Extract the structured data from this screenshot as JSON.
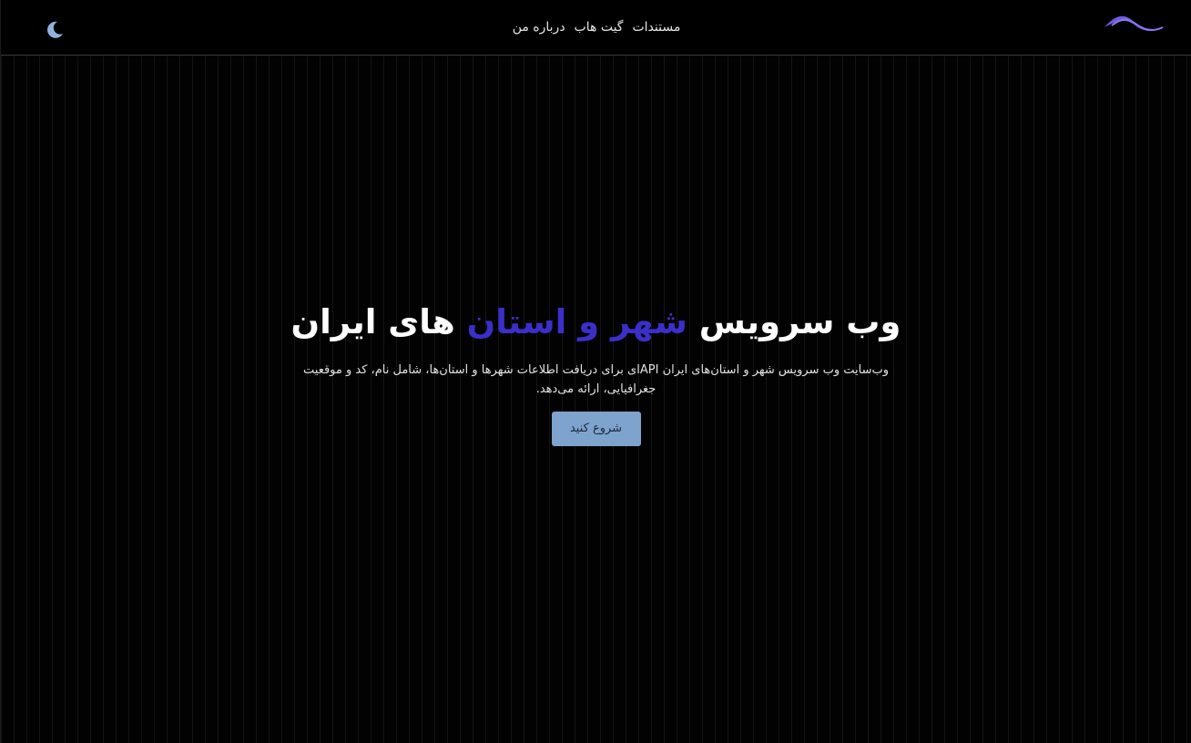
{
  "navbar": {
    "links": [
      {
        "label": "مستندات"
      },
      {
        "label": "گیت هاب"
      },
      {
        "label": "درباره من"
      }
    ],
    "logo_icon": "wave-logo-icon",
    "theme_toggle_icon": "moon-icon"
  },
  "hero": {
    "title_part1": "وب سرویس",
    "title_accent": "شهر و استان",
    "title_part2": "های ایران",
    "description": "وب‌سایت وب سرویس شهر و استان‌های ایران APIای برای دریافت اطلاعات شهرها و استان‌ها، شامل نام، کد و موقعیت جغرافیایی، ارائه می‌دهد.",
    "cta_label": "شروع کنید"
  },
  "colors": {
    "background": "#020202",
    "accent": "#3b2fc9",
    "button": "#7ea3cc",
    "logo": "#6f5be0",
    "moon": "#8fb4dc"
  }
}
